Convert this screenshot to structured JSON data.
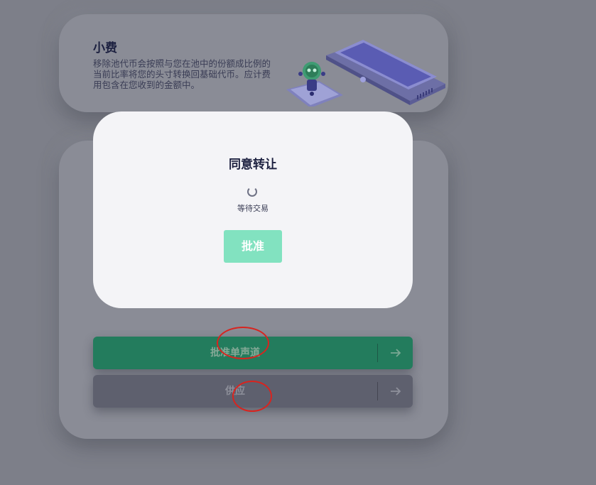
{
  "fee_card": {
    "title": "小费",
    "description": "移除池代币会按照与您在池中的份额成比例的当前比率将您的头寸转换回基础代币。应计费用包含在您收到的金额中。"
  },
  "actions": {
    "approve_label": "批准单声道",
    "supply_label": "供应"
  },
  "modal": {
    "title": "同意转让",
    "status": "等待交易",
    "approve_label": "批准"
  },
  "icons": {
    "arrow": "arrow-right-icon",
    "spinner": "loading-spinner-icon",
    "illustration": "laptop-robot-illustration"
  },
  "colors": {
    "approve_button": "#237c5d",
    "supply_button": "#5e606e",
    "modal_approve": "#82e2c0",
    "annotation": "#d8241f"
  }
}
